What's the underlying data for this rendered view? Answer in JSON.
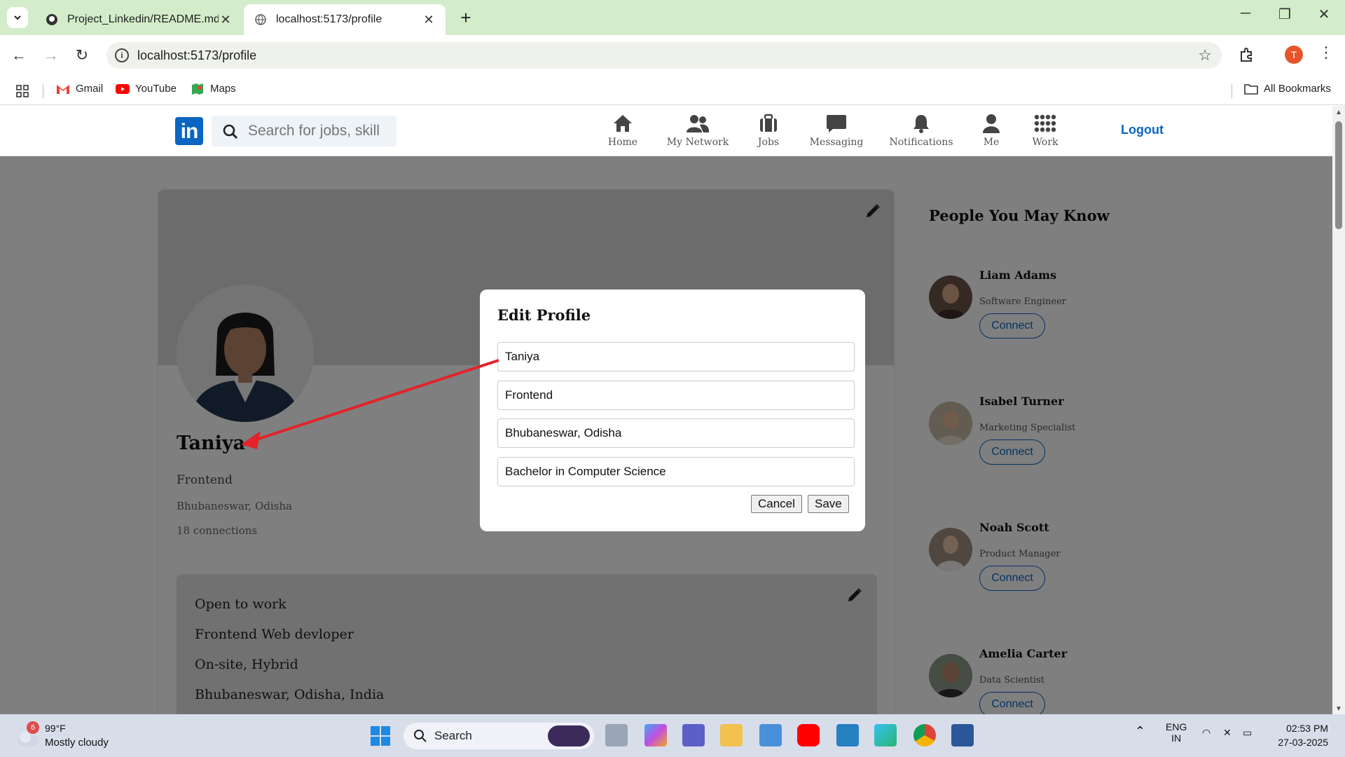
{
  "browser": {
    "tabs": [
      {
        "title": "Project_Linkedin/README.md at",
        "active": false
      },
      {
        "title": "localhost:5173/profile",
        "active": true
      }
    ],
    "url": "localhost:5173/profile",
    "profile_initial": "T",
    "bookmarks": [
      "Gmail",
      "YouTube",
      "Maps"
    ],
    "all_bookmarks": "All Bookmarks"
  },
  "header": {
    "logo": "in",
    "search_placeholder": "Search for jobs, skill",
    "nav": [
      "Home",
      "My Network",
      "Jobs",
      "Messaging",
      "Notifications",
      "Me",
      "Work"
    ],
    "logout": "Logout"
  },
  "profile": {
    "name": "Taniya",
    "headline": "Frontend",
    "location": "Bhubaneswar, Odisha",
    "connections": "18 connections",
    "open_to_work": [
      "Open to work",
      "Frontend Web devloper",
      "On-site, Hybrid",
      "Bhubaneswar, Odisha, India"
    ]
  },
  "pymk": {
    "title": "People You May Know",
    "connect_label": "Connect",
    "people": [
      {
        "name": "Liam Adams",
        "title": "Software Engineer"
      },
      {
        "name": "Isabel Turner",
        "title": "Marketing Specialist"
      },
      {
        "name": "Noah Scott",
        "title": "Product Manager"
      },
      {
        "name": "Amelia Carter",
        "title": "Data Scientist"
      }
    ]
  },
  "modal": {
    "title": "Edit Profile",
    "fields": [
      "Taniya",
      "Frontend",
      "Bhubaneswar, Odisha",
      "Bachelor in Computer Science"
    ],
    "cancel": "Cancel",
    "save": "Save"
  },
  "taskbar": {
    "weather_badge": "6",
    "temperature": "99°F",
    "condition": "Mostly cloudy",
    "search": "Search",
    "lang_1": "ENG",
    "lang_2": "IN",
    "time": "02:53 PM",
    "date": "27-03-2025"
  },
  "colors": {
    "linkedin_blue": "#0a66c2",
    "tabstrip": "#d3ecc9",
    "annotation_arrow": "#e0242a"
  }
}
